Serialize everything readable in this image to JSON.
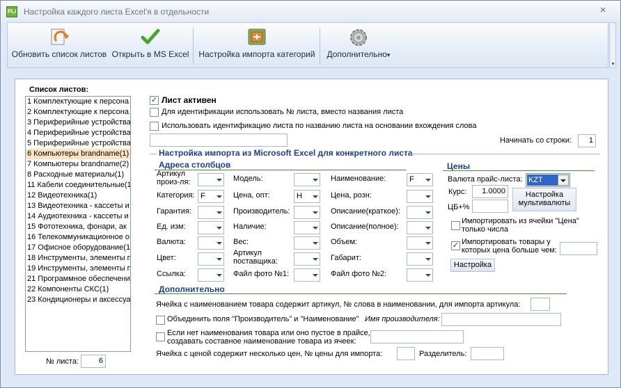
{
  "window": {
    "title": "Настройка каждого листа Excel'я в отдельности",
    "app_icon": "PLi",
    "close": "×"
  },
  "toolbar": {
    "refresh": "Обновить список листов",
    "open_excel": "Открыть в MS Excel",
    "import_categories": "Настройка импорта категорий",
    "more": "Дополнительно",
    "more_arrow": "▾"
  },
  "sheets": {
    "title": "Список листов:",
    "items": [
      "1 Комплектующие к персона",
      "2 Комплектующие к персона",
      "3 Периферийные устройства",
      "4 Периферийные устройства",
      "5 Периферийные устройства",
      "6 Компьютеры brandname(1)",
      "7 Компьютеры brandname(2)",
      "8 Расходные материалы(1)",
      "11 Кабели соединительные(1",
      "12 Видеотехника(1)",
      "13 Видеотехника - кассеты и",
      "14 Аудиотехника - кассеты и",
      "15 Фототехника, фонари, ак",
      "16 Телекоммуникационное о",
      "17 Офисное оборудование(1",
      "18 Инструменты, элементы п",
      "19 Инструменты, элементы п",
      "21 Программное обеспечение",
      "22 Компоненты СКС(1)",
      "23 Кондиционеры и аксессуа"
    ],
    "selected_index": 5,
    "number_label": "№ листа:",
    "number_value": "6"
  },
  "sheet_options": {
    "active": "Лист активен",
    "use_number": "Для идентификации использовать № листа, вместо названия листа",
    "use_name_entry": "Использовать идентификацию листа по названию листа на основании вхождения слова",
    "start_row_label": "Начинать со строки:",
    "start_row_value": "1"
  },
  "import_section": {
    "title": "Настройка импорта из Microsoft Excel для конкретного листа",
    "columns_title": "Адреса столбцов",
    "col1": [
      {
        "label": "Артикул\nпроиз-ля:",
        "value": ""
      },
      {
        "label": "Категория:",
        "value": "F"
      },
      {
        "label": "Гарантия:",
        "value": ""
      },
      {
        "label": "Ед. изм:",
        "value": ""
      },
      {
        "label": "Валюта:",
        "value": ""
      },
      {
        "label": "Цвет:",
        "value": ""
      },
      {
        "label": "Ссылка:",
        "value": ""
      }
    ],
    "col2": [
      {
        "label": "Модель:",
        "value": ""
      },
      {
        "label": "Цена, опт:",
        "value": "H"
      },
      {
        "label": "Производитель:",
        "value": ""
      },
      {
        "label": "Наличие:",
        "value": ""
      },
      {
        "label": "Вес:",
        "value": ""
      },
      {
        "label": "Артикул\nпоставщика:",
        "value": ""
      },
      {
        "label": "Файл фото №1:",
        "value": ""
      }
    ],
    "col3": [
      {
        "label": "Наименование:",
        "value": "F"
      },
      {
        "label": "Цена, розн:",
        "value": ""
      },
      {
        "label": "Описание(краткое):",
        "value": ""
      },
      {
        "label": "Описание(полное):",
        "value": ""
      },
      {
        "label": "Объем:",
        "value": ""
      },
      {
        "label": "Габарит:",
        "value": ""
      },
      {
        "label": "Файл фото №2:",
        "value": ""
      }
    ]
  },
  "prices": {
    "title": "Цены",
    "currency_label": "Валюта прайс-листа:",
    "currency_value": "KZT",
    "rate_label": "Курс:",
    "rate_value": "1.0000",
    "multicurrency_btn": "Настройка мультивалюты",
    "cb_label": "ЦБ+%",
    "cb_value": "",
    "price_numbers_only": "Импортировать из ячейки \"Цена\" только числа",
    "import_price_gt": "Импортировать товары у которых цена больше чем:",
    "import_price_gt_value": "",
    "settings_btn": "Настройка"
  },
  "extra": {
    "title": "Дополнительно",
    "article_in_name": "Ячейка с наименованием товара содержит артикул, № слова в наименовании, для импорта артикула:",
    "article_in_name_value": "",
    "merge_fields": "Объединить поля \"Производитель\" и \"Наименование\"",
    "maker_name_label": "Имя производителя:",
    "maker_name_value": "",
    "composite_name": "Если нет наименования товара или оно пустое в прайсе, создавать составное наименование товара из ячеек:",
    "composite_value": "",
    "multi_price": "Ячейка с ценой содержит несколько цен, № цены для импорта:",
    "multi_price_value": "",
    "separator_label": "Разделитель:",
    "separator_value": ""
  }
}
